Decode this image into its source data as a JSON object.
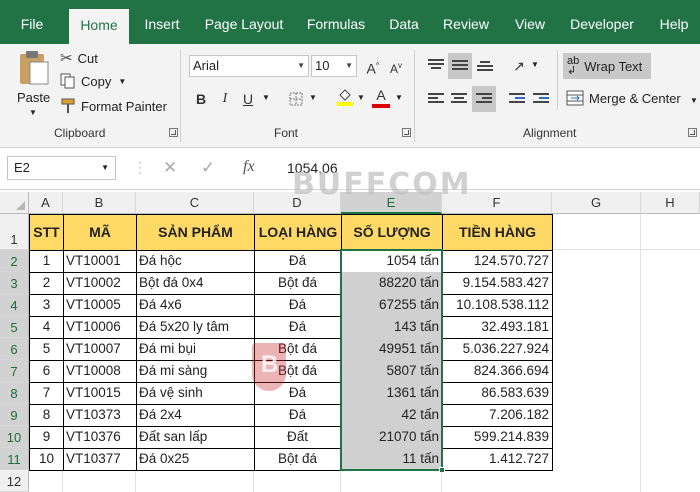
{
  "ribbon_tabs": [
    "File",
    "Home",
    "Insert",
    "Page Layout",
    "Formulas",
    "Data",
    "Review",
    "View",
    "Developer",
    "Help"
  ],
  "clipboard": {
    "paste_label": "Paste",
    "cut_label": "Cut",
    "copy_label": "Copy",
    "format_painter_label": "Format Painter",
    "group_label": "Clipboard"
  },
  "font": {
    "font_name": "Arial",
    "font_size": "10",
    "group_label": "Font",
    "bold": "B",
    "italic": "I",
    "underline": "U",
    "grow": "A",
    "shrink": "A",
    "font_color": "A"
  },
  "alignment": {
    "wrap_text_label": "Wrap Text",
    "merge_center_label": "Merge & Center",
    "group_label": "Alignment"
  },
  "formula_bar": {
    "name_box": "E2",
    "fx": "fx",
    "value": "1054,06"
  },
  "watermark": {
    "text": "BUFFCOM",
    "logo_letter": "B"
  },
  "columns": [
    "A",
    "B",
    "C",
    "D",
    "E",
    "F",
    "G",
    "H"
  ],
  "rows": [
    "1",
    "2",
    "3",
    "4",
    "5",
    "6",
    "7",
    "8",
    "9",
    "10",
    "11",
    "12"
  ],
  "table": {
    "headers": [
      "STT",
      "MÃ",
      "SẢN PHẨM",
      "LOẠI HÀNG",
      "SỐ LƯỢNG",
      "TIỀN HÀNG"
    ],
    "rows": [
      [
        "1",
        "VT10001",
        "Đá hộc",
        "Đá",
        "1054 tấn",
        "124.570.727"
      ],
      [
        "2",
        "VT10002",
        "Bột đá 0x4",
        "Bột đá",
        "88220 tấn",
        "9.154.583.427"
      ],
      [
        "3",
        "VT10005",
        "Đá 4x6",
        "Đá",
        "67255 tấn",
        "10.108.538.112"
      ],
      [
        "4",
        "VT10006",
        "Đá 5x20 ly tâm",
        "Đá",
        "143 tấn",
        "32.493.181"
      ],
      [
        "5",
        "VT10007",
        "Đá mi bụi",
        "Bột đá",
        "49951 tấn",
        "5.036.227.924"
      ],
      [
        "6",
        "VT10008",
        "Đá mi sàng",
        "Bột đá",
        "5807 tấn",
        "824.366.694"
      ],
      [
        "7",
        "VT10015",
        "Đá vệ sinh",
        "Đá",
        "1361 tấn",
        "86.583.639"
      ],
      [
        "8",
        "VT10373",
        "Đá 2x4",
        "Đá",
        "42 tấn",
        "7.206.182"
      ],
      [
        "9",
        "VT10376",
        "Đất san lấp",
        "Đất",
        "21070 tấn",
        "599.214.839"
      ],
      [
        "10",
        "VT10377",
        "Đá 0x25",
        "Bột đá",
        "11 tấn",
        "1.412.727"
      ]
    ]
  },
  "colors": {
    "excel_green": "#217346",
    "header_fill": "#ffd966",
    "selection_fill": "#d0d0d0"
  },
  "icons": [
    "paste-icon",
    "scissors-icon",
    "copy-icon",
    "format-painter-icon",
    "dropdown-icon",
    "fill-color-icon",
    "borders-icon",
    "wrap-text-icon",
    "merge-icon",
    "cancel-icon",
    "enter-icon"
  ]
}
